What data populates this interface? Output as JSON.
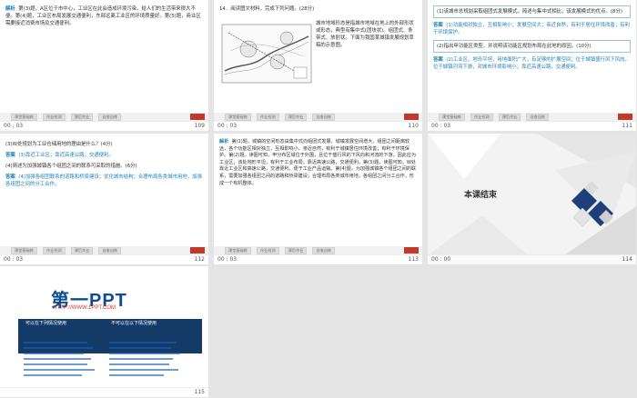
{
  "slides": [
    {
      "id": 109,
      "paragraphs": [
        {
          "label": "解析",
          "text": "第(3)题，A区位于市中心，工业区在此会造成环境污染，给人们的生活带来很大不便。第(4)题，工业区布局发展交通便利，东部远离工业区的环境质量好。第(5)题，商业区需要接近消费市场及交通便利。"
        }
      ],
      "footer": {
        "left": "00 : 03",
        "right": "109"
      }
    },
    {
      "id": 110,
      "paragraphs": [
        {
          "label": "",
          "text": "14．阅读图文材料，完成下列问题。(28分)"
        },
        {
          "label": "",
          "text": "城市地域形态是指城市地域在地上的外部形状或形态，典型有集中式(团块状)、组团式、条带式、放射状。下面为我国某城镇发展规划草稿的示意图。"
        }
      ],
      "footer": {
        "left": "00 : 03",
        "right": "110"
      }
    },
    {
      "id": 111,
      "paragraphs": [
        {
          "label": "",
          "text": "(1)该城市总规划采取组团式发展模式，简述与集中式相比，该发展模式的优点。(8分)",
          "boxed": true
        },
        {
          "label": "答案",
          "text": "(1)功能相对独立，互相影响小；发展空间大；亲近自然，有利于居住环境改善；有利于环境保护。",
          "answer": true
        },
        {
          "label": "",
          "text": "(2)指出甲功能区类型，并说明该功能区规划布局在此地的原因。(10分)",
          "boxed": true
        },
        {
          "label": "答案",
          "text": "(2)工业区。地形平坦，用地面积广大，有足够的扩展空间；位于城镇盛行风下风向，位于城镇河流下游，对城市环境影响小；靠近高速公路，交通便利。",
          "answer": true
        }
      ],
      "footer": {
        "left": "00 : 03",
        "right": "111"
      }
    },
    {
      "id": 112,
      "paragraphs": [
        {
          "label": "",
          "text": "(3)W处规划为工业仓储用地的理由是什么？(4分)"
        },
        {
          "label": "答案",
          "text": "(3)靠近工业区；靠近高速公路，交通便利。",
          "answer": true
        },
        {
          "label": "",
          "text": "(4)简述为加强城镇各个组团之间的联系可采取的措施。(6分)"
        },
        {
          "label": "答案",
          "text": "(4)加强各组团联系的道路和桥梁建设；优化城市结构；合理布局各类城市用地，加强各组团之间的分工合作。",
          "answer": true
        }
      ],
      "footer": {
        "left": "00 : 03",
        "right": "112"
      }
    },
    {
      "id": 113,
      "paragraphs": [
        {
          "label": "解析",
          "text": "第(1)题，城镇的空间形态由集中式向组团式发展，城镇发展空间增大，组团之间距离较远，各个功能区相对独立，互相影响小，亲近自然，有利于城镇居住环境改善；有利于环境保护。第(2)题，读图可知，甲分布区域位于外围，且位于盛行风的下风向和河流的下游，因此应为工业区；该处地形平坦，有利于工业布局；靠近高速公路，交通便利。第(3)题，读图可知，W处靠近工业区和高速公路，交通便利，便于工业产品运输。第(4)题，为加强城镇各个组团之间的联系，需要加强各组团之间的道路和桥梁建设；合理布局各类城市用地，各组团之间分工合作，形成一个有机整体。"
        }
      ],
      "footer": {
        "left": "00 : 03",
        "right": "113"
      }
    }
  ],
  "end_slide": {
    "title": "本课结束",
    "footer": {
      "left": "00 : 00",
      "right": "114"
    }
  },
  "ppt_slide": {
    "logo": "第一PPT",
    "url": "HTTP://WWW.1PPT.COM",
    "can_title": "可以在下列情况使用",
    "cannot_title": "不可以在以下情况使用",
    "footer": {
      "right": "115"
    }
  },
  "nav_buttons": [
    "课堂基础练",
    "作业检测",
    "课后作业",
    "自查自练"
  ],
  "colors": {
    "accent": "#1f7fb8",
    "dark_blue": "#143a68",
    "red": "#d13b2d"
  }
}
